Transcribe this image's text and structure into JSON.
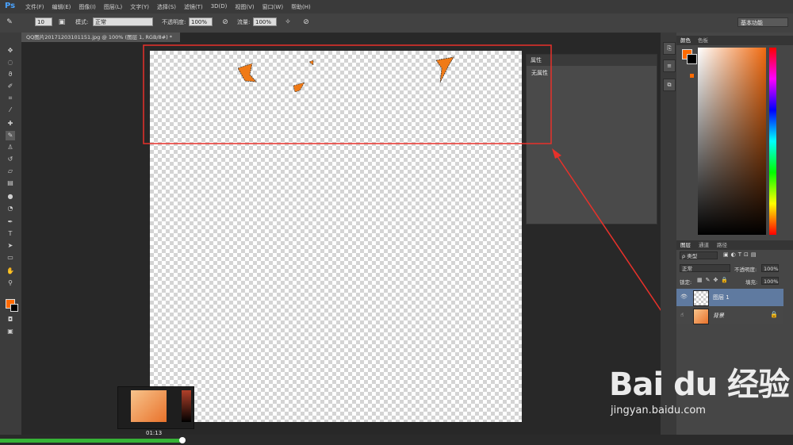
{
  "app": {
    "logo": "Ps"
  },
  "menu": [
    "文件(F)",
    "编辑(E)",
    "图像(I)",
    "图层(L)",
    "文字(Y)",
    "选择(S)",
    "滤镜(T)",
    "3D(D)",
    "视图(V)",
    "窗口(W)",
    "帮助(H)"
  ],
  "options": {
    "brush_size": "10",
    "mode_label": "模式:",
    "mode_value": "正常",
    "opacity_label": "不透明度:",
    "opacity_value": "100%",
    "flow_label": "流量:",
    "flow_value": "100%",
    "workspace": "基本功能"
  },
  "document": {
    "tab_title": "QQ图片20171203101151.jpg @ 100% (图层 1, RGB/8#) *"
  },
  "properties_panel": {
    "tab": "属性",
    "empty_text": "无属性"
  },
  "color_panel": {
    "tabs": [
      "颜色",
      "色板"
    ],
    "foreground": "#ff6a00",
    "background": "#000000"
  },
  "layers_panel": {
    "tabs": [
      "图层",
      "通道",
      "路径"
    ],
    "filter_label": "ρ 类型",
    "blend_mode": "正常",
    "opacity_label": "不透明度:",
    "opacity_value": "100%",
    "lock_label": "锁定:",
    "fill_label": "填充:",
    "fill_value": "100%",
    "layers": [
      {
        "name": "图层 1",
        "selected": true
      },
      {
        "name": "背景",
        "selected": false,
        "locked": true
      }
    ]
  },
  "video": {
    "time": "01:13",
    "progress": 0.23
  },
  "watermark": {
    "brand": "Bai du 经验",
    "url": "jingyan.baidu.com"
  },
  "annotation_color": "#e8312a"
}
